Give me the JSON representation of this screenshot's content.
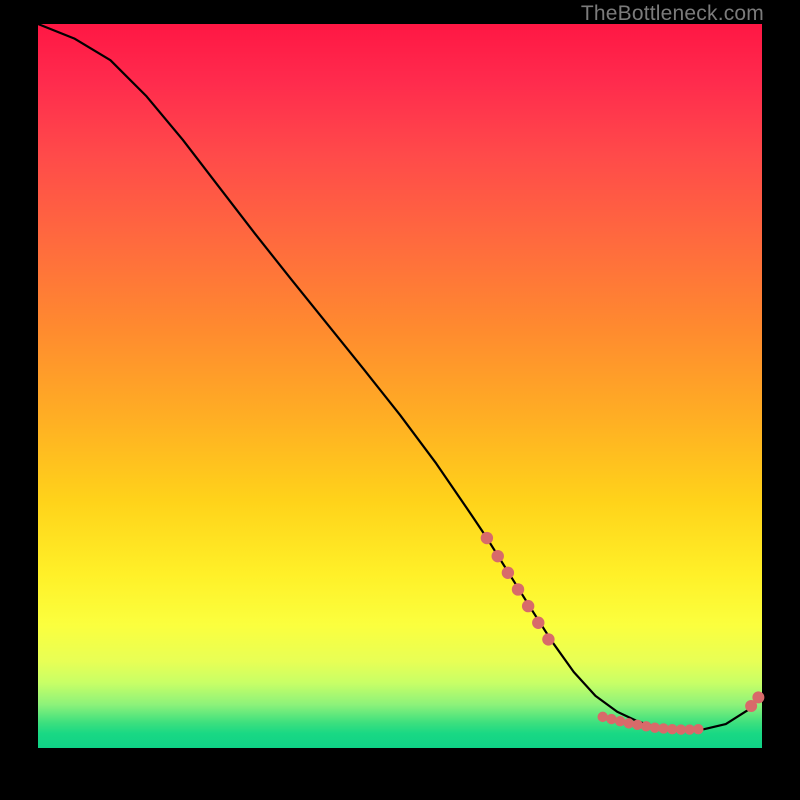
{
  "watermark": "TheBottleneck.com",
  "chart_data": {
    "type": "line",
    "title": "",
    "xlabel": "",
    "ylabel": "",
    "xlim": [
      0,
      100
    ],
    "ylim": [
      0,
      100
    ],
    "series": [
      {
        "name": "curve",
        "x": [
          0,
          5,
          10,
          15,
          20,
          25,
          30,
          35,
          40,
          45,
          50,
          55,
          60,
          62,
          65,
          68,
          71,
          74,
          77,
          80,
          83,
          86,
          89,
          92,
          95,
          98,
          100
        ],
        "y": [
          100,
          98,
          95,
          90,
          84,
          77.5,
          71,
          64.7,
          58.5,
          52.3,
          46,
          39.3,
          32,
          29,
          24.2,
          19.4,
          14.7,
          10.5,
          7.2,
          5,
          3.6,
          2.8,
          2.5,
          2.6,
          3.3,
          5.2,
          7.3
        ]
      }
    ],
    "markers_left": [
      {
        "x": 62.0,
        "y": 29.0
      },
      {
        "x": 63.5,
        "y": 26.5
      },
      {
        "x": 64.9,
        "y": 24.2
      },
      {
        "x": 66.3,
        "y": 21.9
      },
      {
        "x": 67.7,
        "y": 19.6
      },
      {
        "x": 69.1,
        "y": 17.3
      },
      {
        "x": 70.5,
        "y": 15.0
      }
    ],
    "markers_bottom": [
      {
        "x": 78.0,
        "y": 4.3
      },
      {
        "x": 79.2,
        "y": 4.0
      },
      {
        "x": 80.4,
        "y": 3.7
      },
      {
        "x": 81.6,
        "y": 3.4
      },
      {
        "x": 82.8,
        "y": 3.2
      },
      {
        "x": 84.0,
        "y": 3.0
      },
      {
        "x": 85.2,
        "y": 2.8
      },
      {
        "x": 86.4,
        "y": 2.7
      },
      {
        "x": 87.6,
        "y": 2.6
      },
      {
        "x": 88.8,
        "y": 2.55
      },
      {
        "x": 90.0,
        "y": 2.55
      },
      {
        "x": 91.2,
        "y": 2.6
      }
    ],
    "markers_right": [
      {
        "x": 98.5,
        "y": 5.8
      },
      {
        "x": 99.5,
        "y": 7.0
      }
    ],
    "marker_color": "#d86a6a",
    "curve_color": "#000000"
  }
}
